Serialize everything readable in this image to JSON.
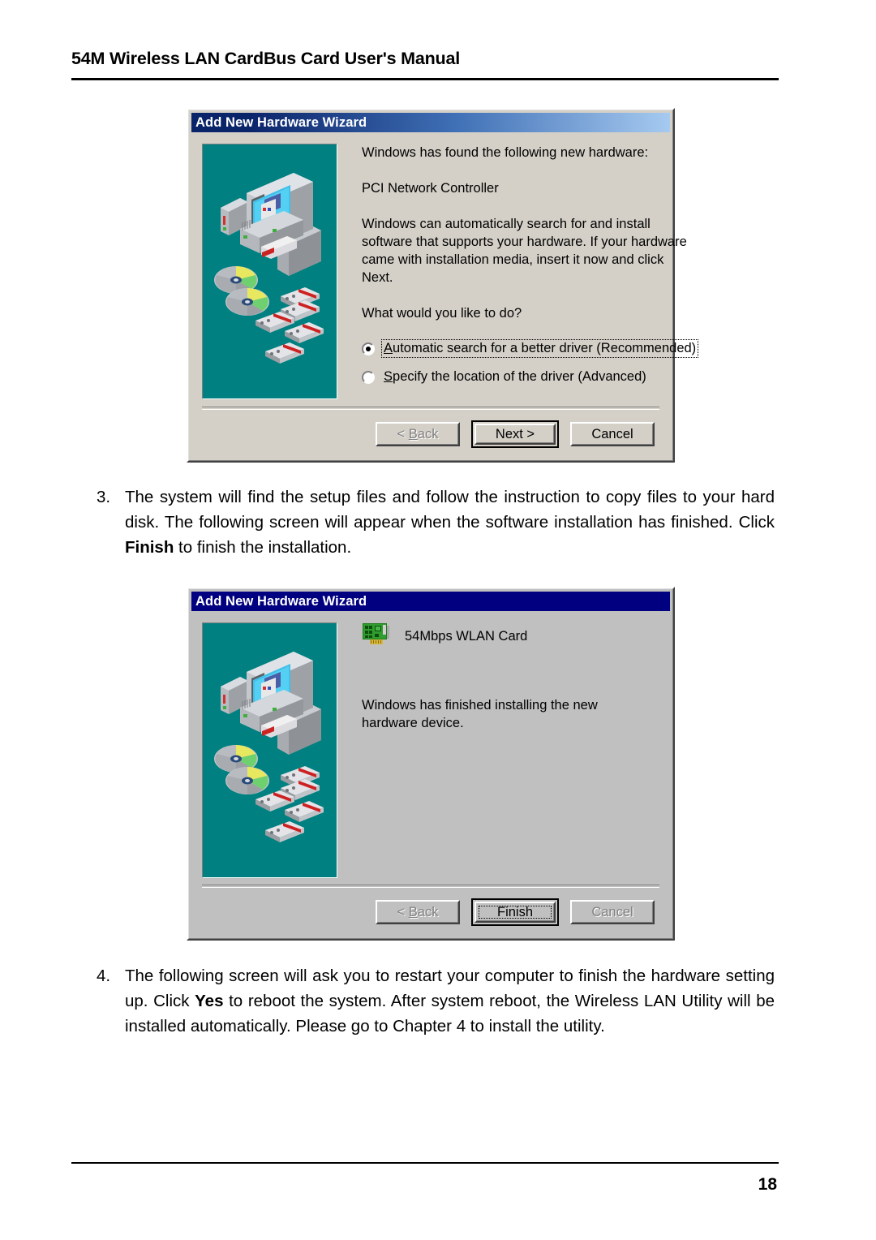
{
  "page": {
    "header_title": "54M Wireless LAN CardBus Card User's Manual",
    "page_number": "18"
  },
  "steps": [
    {
      "number": "3.",
      "text_part1": "The system will find the setup files and follow the instruction to copy files to your hard disk. The following screen will appear when the software installation has finished. Click ",
      "bold": "Finish",
      "text_part2": " to finish the installation."
    },
    {
      "number": "4.",
      "text_part1": "The following screen will ask you to restart your computer to finish the hardware setting up. Click ",
      "bold": "Yes",
      "text_part2": " to reboot the system. After system reboot, the Wireless LAN Utility will be installed automatically. Please go to Chapter 4 to install the utility."
    }
  ],
  "dialog1": {
    "title": "Add New Hardware Wizard",
    "heading": "Windows has found the following new hardware:",
    "device_name": "PCI Network Controller",
    "body_paragraph": "Windows can automatically search for and install software that supports your hardware. If your hardware came with installation media, insert it now and click Next.",
    "question": "What would you like to do?",
    "options": [
      {
        "label_accel": "A",
        "label_rest": "utomatic search for a better driver (Recommended)",
        "selected": true
      },
      {
        "label_accel": "S",
        "label_rest": "pecify the location of the driver (Advanced)",
        "selected": false
      }
    ],
    "buttons": [
      {
        "name": "back",
        "prefix": "< ",
        "accel": "B",
        "rest": "ack",
        "state": "disabled",
        "default": false
      },
      {
        "name": "next",
        "prefix": "",
        "accel": "",
        "rest": "Next >",
        "state": "enabled",
        "default": true
      },
      {
        "name": "cancel",
        "prefix": "",
        "accel": "",
        "rest": "Cancel",
        "state": "enabled",
        "default": false
      }
    ]
  },
  "dialog2": {
    "title": "Add New Hardware Wizard",
    "device_name": "54Mbps WLAN Card",
    "device_icon": "pci-card-icon",
    "body_paragraph": "Windows has finished installing the new hardware device.",
    "buttons": [
      {
        "name": "back",
        "prefix": "< ",
        "accel": "B",
        "rest": "ack",
        "state": "disabled",
        "default": false
      },
      {
        "name": "finish",
        "prefix": "",
        "accel": "",
        "rest": "Finish",
        "state": "enabled",
        "default": true
      },
      {
        "name": "cancel",
        "prefix": "",
        "accel": "",
        "rest": "Cancel",
        "state": "disabled",
        "default": false
      }
    ]
  },
  "colors": {
    "titlebar_gradient_start": "#0a246a",
    "titlebar_gradient_end": "#a6caf0",
    "titlebar_solid": "#000080",
    "dialog1_face": "#d4d0c8",
    "dialog2_face": "#c0c0c0",
    "illustration_background": "#008080"
  }
}
